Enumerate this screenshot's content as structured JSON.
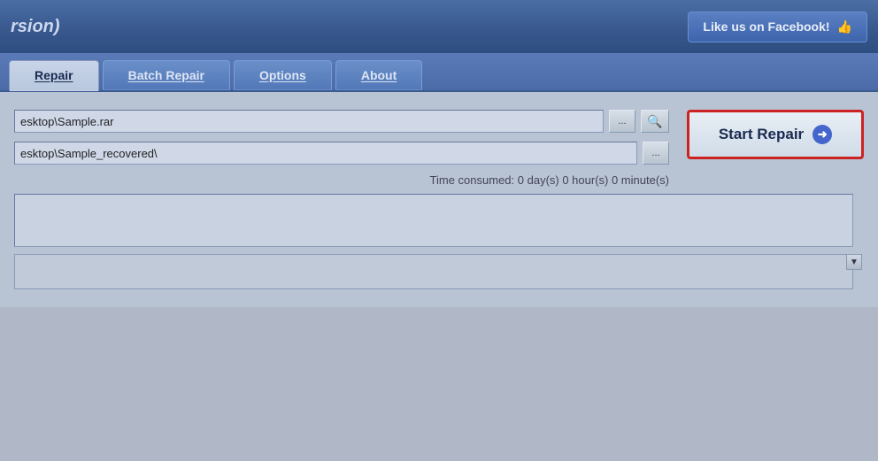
{
  "header": {
    "title": "rsion)",
    "facebook_label": "Like us on Facebook!",
    "facebook_icon": "thumbs-up"
  },
  "tabs": [
    {
      "id": "repair",
      "label": "Repair",
      "active": true
    },
    {
      "id": "batch-repair",
      "label": "Batch Repair",
      "active": false
    },
    {
      "id": "options",
      "label": "Options",
      "active": false
    },
    {
      "id": "about",
      "label": "About",
      "active": false
    }
  ],
  "fields": {
    "source_file": {
      "value": "esktop\\Sample.rar",
      "placeholder": ""
    },
    "output_folder": {
      "value": "esktop\\Sample_recovered\\",
      "placeholder": ""
    }
  },
  "buttons": {
    "browse1": "...",
    "browse2": "...",
    "start_repair": "Start Repair"
  },
  "status": {
    "time_consumed_label": "Time consumed:",
    "time_consumed_value": "0 day(s) 0 hour(s) 0 minute(s)"
  },
  "scrollbar": {
    "down_arrow": "▼"
  }
}
